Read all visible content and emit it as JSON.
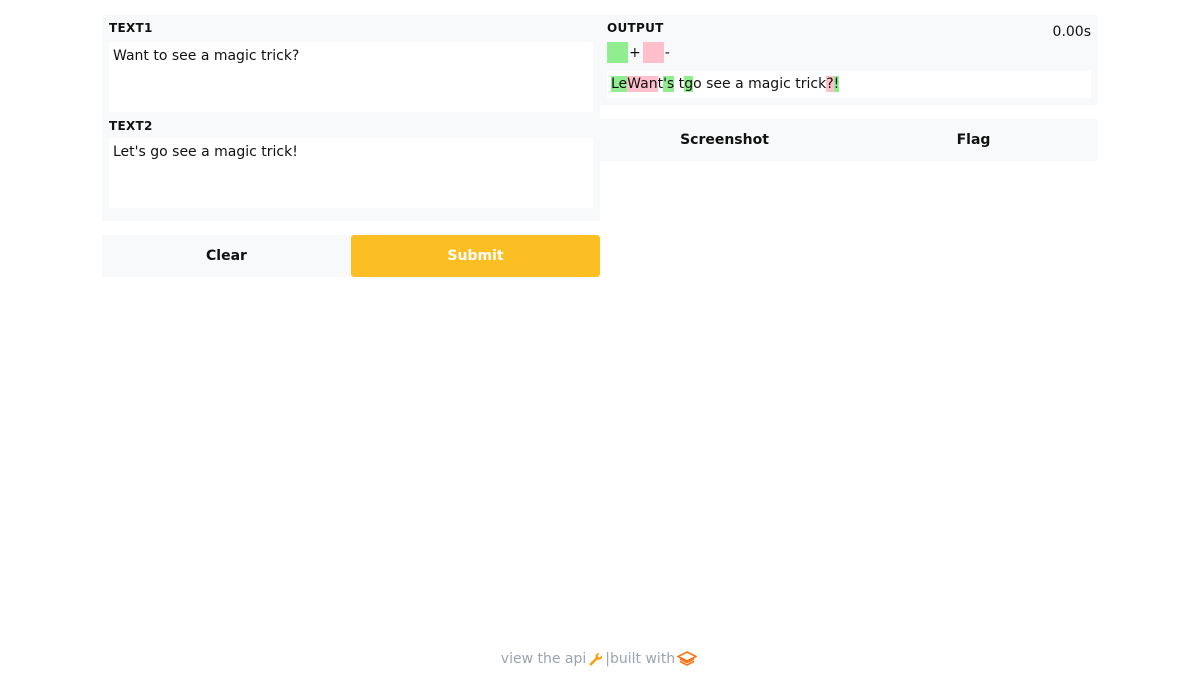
{
  "inputs": {
    "text1": {
      "label": "TEXT1",
      "value": "Want to see a magic trick?"
    },
    "text2": {
      "label": "TEXT2",
      "value": "Let's go see a magic trick!"
    }
  },
  "buttons": {
    "clear_label": "Clear",
    "submit_label": "Submit",
    "screenshot_label": "Screenshot",
    "flag_label": "Flag"
  },
  "output": {
    "label": "OUTPUT",
    "timer": "0.00s",
    "legend": {
      "added_symbol": "+",
      "removed_symbol": "-"
    },
    "diff": [
      {
        "text": "Le",
        "type": "added"
      },
      {
        "text": "Wan",
        "type": "removed"
      },
      {
        "text": "t",
        "type": "same"
      },
      {
        "text": "'s",
        "type": "added"
      },
      {
        "text": " t",
        "type": "same"
      },
      {
        "text": "g",
        "type": "added"
      },
      {
        "text": "o see a magic trick",
        "type": "same"
      },
      {
        "text": "?",
        "type": "removed"
      },
      {
        "text": "!",
        "type": "added"
      }
    ]
  },
  "footer": {
    "api_text": "view the api",
    "separator": "|",
    "built_with": "built with"
  },
  "colors": {
    "added": "#90ee90",
    "removed": "#ffc0cb",
    "submit": "#fbbf24",
    "panel": "#f8f9fa"
  },
  "icons": {
    "api": "wrench-icon",
    "brand": "gradio-logo-icon"
  }
}
